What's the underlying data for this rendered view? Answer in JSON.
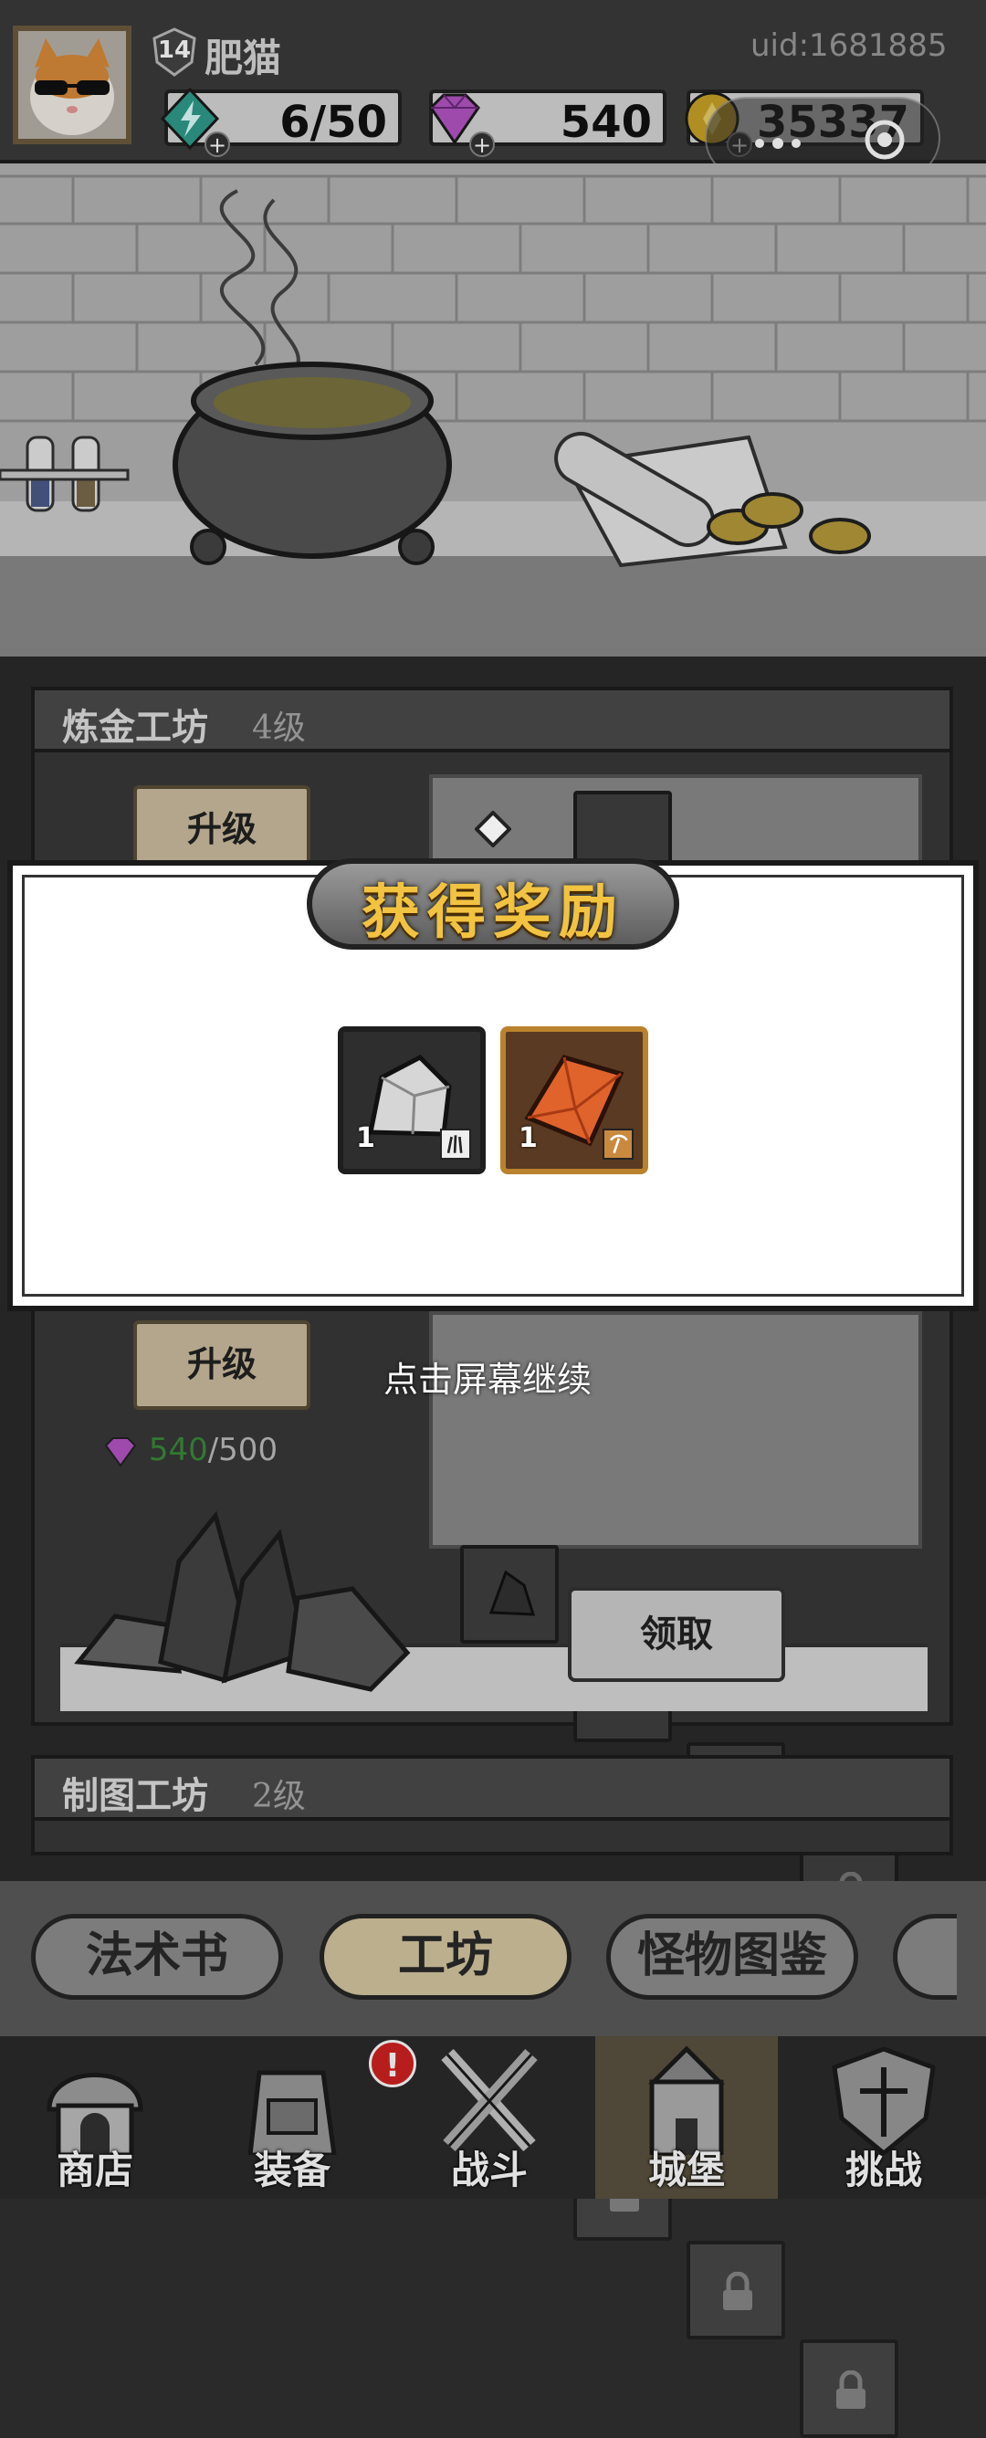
{
  "player": {
    "name": "肥猫",
    "level": "14",
    "uid": "uid:1681885"
  },
  "resources": {
    "energy": "6/50",
    "gems": "540",
    "coins": "35337"
  },
  "workshops": [
    {
      "title": "炼金工坊",
      "level": "4级",
      "upgrade_label": "升级"
    },
    {
      "title": "制图工坊",
      "level": "2级"
    }
  ],
  "mining": {
    "upgrade_label": "升级",
    "gem_current": "540",
    "gem_max": "/500",
    "claim_label": "领取"
  },
  "reward_modal": {
    "title": "获得奖励",
    "items": [
      {
        "name": "silver-ore",
        "count": "1"
      },
      {
        "name": "fire-crystal",
        "count": "1"
      }
    ],
    "hint": "点击屏幕继续"
  },
  "tabs": [
    {
      "label": "法术书",
      "active": false
    },
    {
      "label": "工坊",
      "active": true
    },
    {
      "label": "怪物图鉴",
      "active": false
    }
  ],
  "nav": [
    {
      "label": "商店",
      "active": false
    },
    {
      "label": "装备",
      "active": false,
      "badge": "!"
    },
    {
      "label": "战斗",
      "active": false
    },
    {
      "label": "城堡",
      "active": true
    },
    {
      "label": "挑战",
      "active": false
    }
  ],
  "colors": {
    "gem_current": "#3a8a3a",
    "title_gold": "#f2c340",
    "active_tab": "#d7c8a2"
  }
}
